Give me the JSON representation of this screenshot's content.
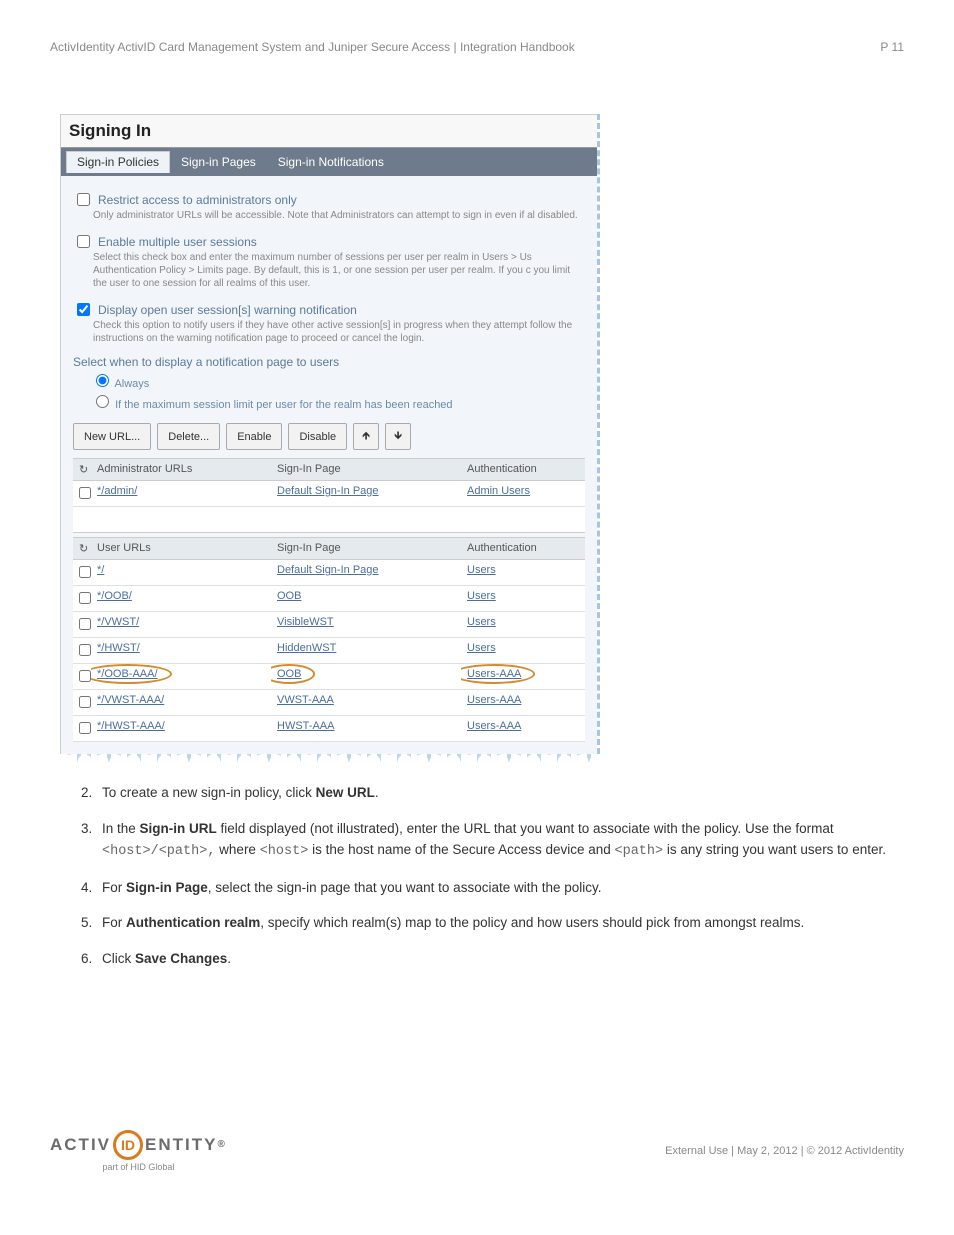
{
  "header": {
    "title": "ActivIdentity ActivID Card Management System and Juniper Secure Access | Integration Handbook",
    "page": "P 11"
  },
  "panel": {
    "title": "Signing In",
    "tabs": [
      "Sign-in Policies",
      "Sign-in Pages",
      "Sign-in Notifications"
    ],
    "opt1_label": "Restrict access to administrators only",
    "opt1_desc": "Only administrator URLs will be accessible. Note that Administrators can attempt to sign in even if al disabled.",
    "opt2_label": "Enable multiple user sessions",
    "opt2_desc": "Select this check box and enter the maximum number of sessions per user per realm in Users > Us Authentication Policy > Limits page. By default, this is 1, or one session per user per realm. If you c you limit the user to one session for all realms of this user.",
    "opt3_label": "Display open user session[s] warning notification",
    "opt3_desc": "Check this option to notify users if they have other active session[s] in progress when they attempt follow the instructions on the warning notification page to proceed or cancel the login.",
    "notif_label": "Select when to display a notification page to users",
    "radio1": "Always",
    "radio2": "If the maximum session limit per user for the realm has been reached",
    "buttons": [
      "New URL...",
      "Delete...",
      "Enable",
      "Disable"
    ],
    "admin_header": {
      "c0": "Administrator URLs",
      "c1": "Sign-In Page",
      "c2": "Authentication"
    },
    "admin_rows": [
      {
        "url": "*/admin/",
        "page": "Default Sign-In Page",
        "auth": "Admin Users"
      }
    ],
    "user_header": {
      "c0": "User URLs",
      "c1": "Sign-In Page",
      "c2": "Authentication"
    },
    "user_rows": [
      {
        "url": "*/",
        "page": "Default Sign-In Page",
        "auth": "Users",
        "circled": false
      },
      {
        "url": "*/OOB/",
        "page": "OOB",
        "auth": "Users",
        "circled": false
      },
      {
        "url": "*/VWST/",
        "page": "VisibleWST",
        "auth": "Users",
        "circled": false
      },
      {
        "url": "*/HWST/",
        "page": "HiddenWST",
        "auth": "Users",
        "circled": false
      },
      {
        "url": "*/OOB-AAA/",
        "page": "OOB",
        "auth": "Users-AAA",
        "circled": true
      },
      {
        "url": "*/VWST-AAA/",
        "page": "VWST-AAA",
        "auth": "Users-AAA",
        "circled": false
      },
      {
        "url": "*/HWST-AAA/",
        "page": "HWST-AAA",
        "auth": "Users-AAA",
        "circled": false
      }
    ]
  },
  "instructions": {
    "s2_a": "To create a new sign-in policy, click ",
    "s2_b": "New URL",
    "s3_a": "In the ",
    "s3_b": "Sign-in URL",
    "s3_c": " field displayed (not illustrated), enter the URL that you want to associate with the policy. Use the format ",
    "s3_d": "<host>/<path>,",
    "s3_e": " where ",
    "s3_f": "<host>",
    "s3_g": " is the host name of the Secure Access device and ",
    "s3_h": "<path>",
    "s3_i": " is any string you want users to enter.",
    "s4_a": "For ",
    "s4_b": "Sign-in Page",
    "s4_c": ", select the sign-in page that you want to associate with the policy.",
    "s5_a": "For ",
    "s5_b": "Authentication realm",
    "s5_c": ", specify which realm(s) map to the policy and how users should pick from amongst realms.",
    "s6_a": "Click ",
    "s6_b": "Save Changes",
    "s6_c": "."
  },
  "footer": {
    "logo_left": "ACTIV",
    "logo_mid": "ID",
    "logo_right": "ENTITY",
    "logo_sub": "part of HID Global",
    "text": "External Use | May 2, 2012 | © 2012 ActivIdentity"
  }
}
